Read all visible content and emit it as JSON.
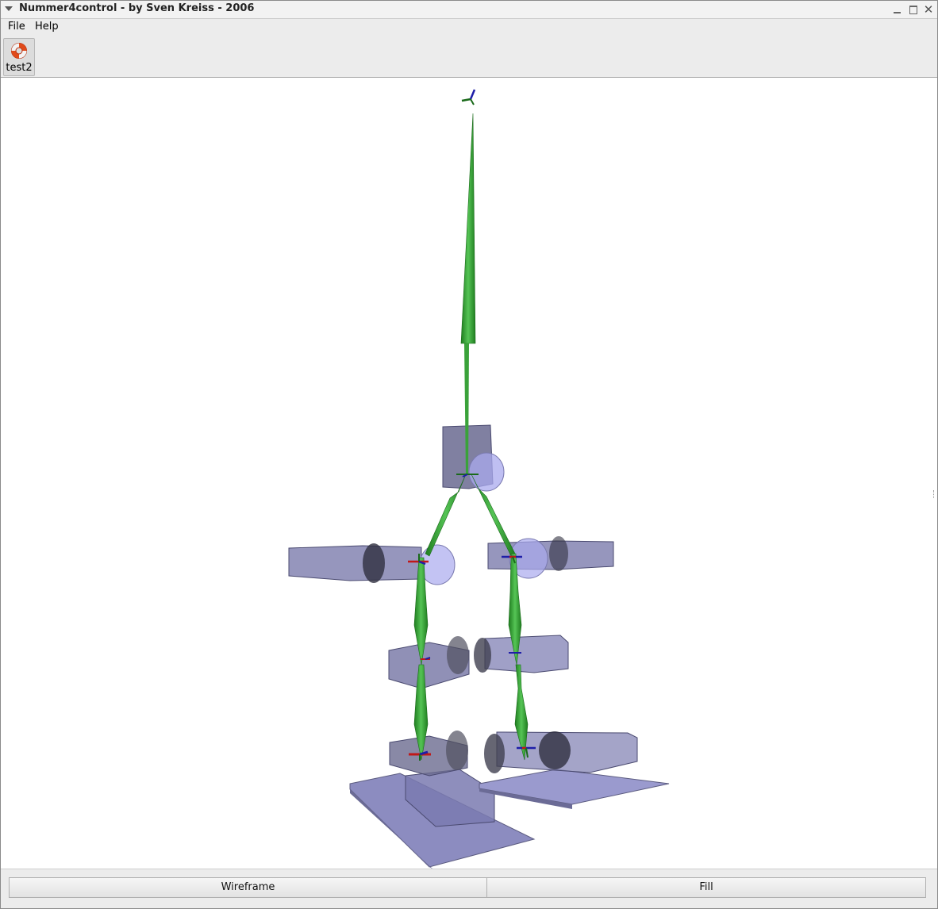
{
  "window": {
    "title": "Nummer4control - by Sven Kreiss - 2006",
    "icons": [
      "menu-arrow-icon",
      "minimize-icon",
      "maximize-icon",
      "close-icon"
    ]
  },
  "menu": {
    "file": "File",
    "help": "Help"
  },
  "toolbar": {
    "test2": {
      "label": "test2",
      "icon": "lifebuoy-icon"
    }
  },
  "viewport": {
    "content": "3D robot skeleton model",
    "colors": {
      "bone": "#33a833",
      "body_box": "#8a8ab8",
      "joint_sphere": "#a9a9ee"
    }
  },
  "buttons": {
    "wireframe": "Wireframe",
    "fill": "Fill"
  }
}
